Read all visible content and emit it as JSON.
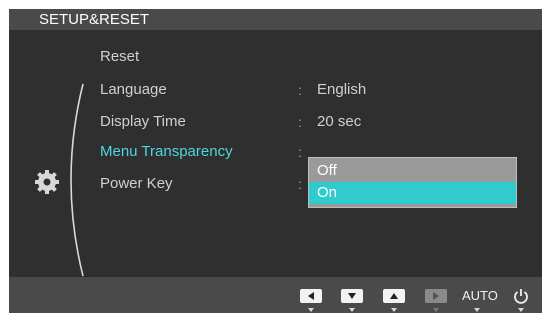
{
  "header": {
    "title": "SETUP&RESET"
  },
  "menu": {
    "items": [
      {
        "label": "Reset",
        "value": ""
      },
      {
        "label": "Language",
        "value": "English"
      },
      {
        "label": "Display Time",
        "value": "20 sec"
      },
      {
        "label": "Menu Transparency",
        "value": "",
        "active": true
      },
      {
        "label": "Power Key",
        "value": ""
      }
    ]
  },
  "dropdown": {
    "options": [
      {
        "label": "Off"
      },
      {
        "label": "On",
        "selected": true
      }
    ]
  },
  "footer": {
    "keys": [
      "left-arrow-icon",
      "down-arrow-icon",
      "up-arrow-icon",
      "right-arrow-icon"
    ],
    "auto_label": "AUTO",
    "power_icon": "power-icon"
  },
  "colors": {
    "accent": "#30cbcd",
    "active_text": "#4fd6dc",
    "background": "#2f2f2f",
    "titlebar": "#4a4a4a"
  }
}
